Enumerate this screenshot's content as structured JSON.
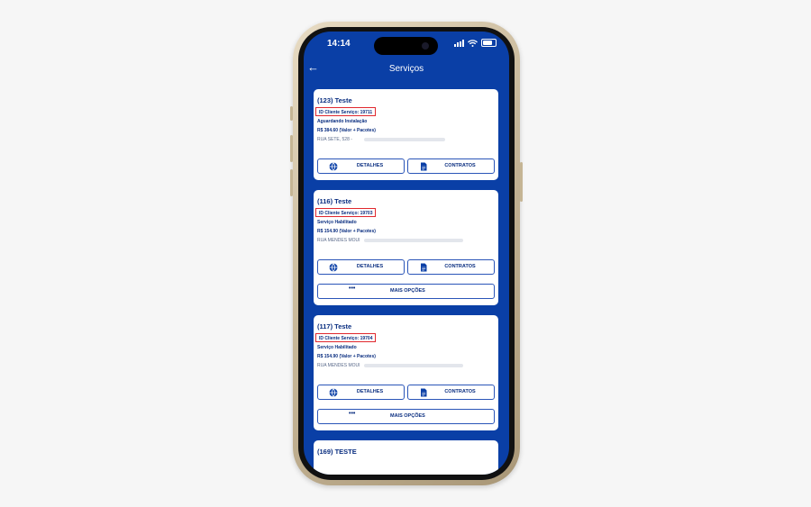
{
  "status_bar": {
    "time": "14:14"
  },
  "header": {
    "title": "Serviços"
  },
  "buttons": {
    "detalhes": "DETALHES",
    "contratos": "CONTRATOS",
    "mais_opcoes": "MAIS OPÇÕES",
    "dots": "•••"
  },
  "cards": [
    {
      "title": "(123) Teste",
      "client_id": "ID Cliente Serviço: 19711",
      "status": "Aguardando Instalação",
      "price": "R$ 384.60 (Valor + Pacotes)",
      "address": "RUA SETE, 528 - "
    },
    {
      "title": "(116) Teste",
      "client_id": "ID Cliente Serviço: 19703",
      "status": "Serviço Habilitado",
      "price": "R$ 154.90 (Valor + Pacotes)",
      "address": "RUA MENDES MOUI"
    },
    {
      "title": "(117) Teste",
      "client_id": "ID Cliente Serviço: 19704",
      "status": "Serviço Habilitado",
      "price": "R$ 154.90 (Valor + Pacotes)",
      "address": "RUA MENDES MOUI"
    },
    {
      "title": "(169) TESTE"
    }
  ],
  "colors": {
    "primary": "#0a3fa6",
    "highlight": "#e0282e",
    "text": "#0a2e80"
  }
}
